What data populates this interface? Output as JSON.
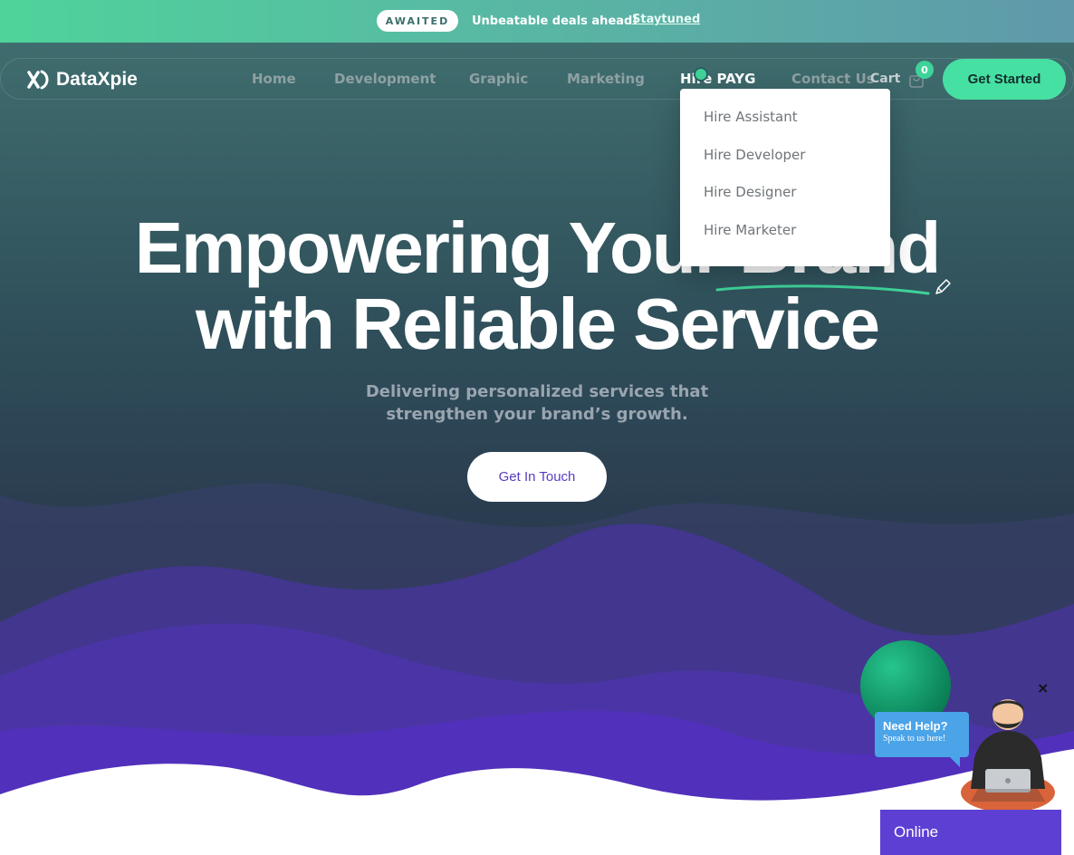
{
  "promo": {
    "badge": "AWAITED",
    "text": "Unbeatable deals ahead!",
    "link": "Staytuned"
  },
  "brand": {
    "name": "DataXpie"
  },
  "nav": {
    "items": [
      "Home",
      "Development",
      "Graphic",
      "Marketing",
      "Hire PAYG",
      "Contact Us"
    ],
    "active": "Hire PAYG",
    "cart_label": "Cart",
    "cart_count": "0",
    "cta": "Get Started"
  },
  "dropdown": {
    "items": [
      "Hire Assistant",
      "Hire Developer",
      "Hire Designer",
      "Hire Marketer"
    ]
  },
  "hero": {
    "line1": "Empowering Your Brand",
    "line2": "with Reliable Service",
    "subtitle_line1": "Delivering personalized services that",
    "subtitle_line2": "strengthen your brand’s growth.",
    "button": "Get In Touch"
  },
  "help": {
    "title": "Need Help?",
    "subtitle": "Speak to us here!",
    "close": "×",
    "status": "Online"
  },
  "colors": {
    "accent": "#47e0a3",
    "purple": "#5e3fd3",
    "dark": "#2a3b4f"
  }
}
